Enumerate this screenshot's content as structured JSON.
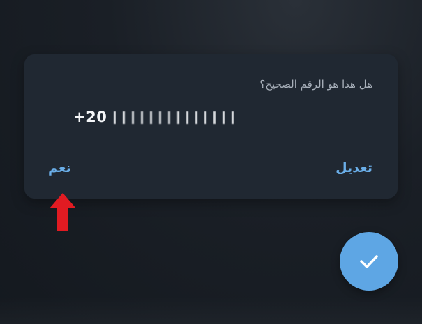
{
  "dialog": {
    "question": "هل هذا هو الرقم الصحيح؟",
    "phone_prefix": "+20",
    "yes_label": "نعم",
    "edit_label": "تعديل"
  },
  "annotation": {
    "arrow_color": "#e11b22"
  },
  "fab": {
    "icon": "check-icon",
    "color": "#5ea6e4"
  },
  "colors": {
    "accent": "#6aaee8",
    "dialog_bg": "#202832"
  }
}
